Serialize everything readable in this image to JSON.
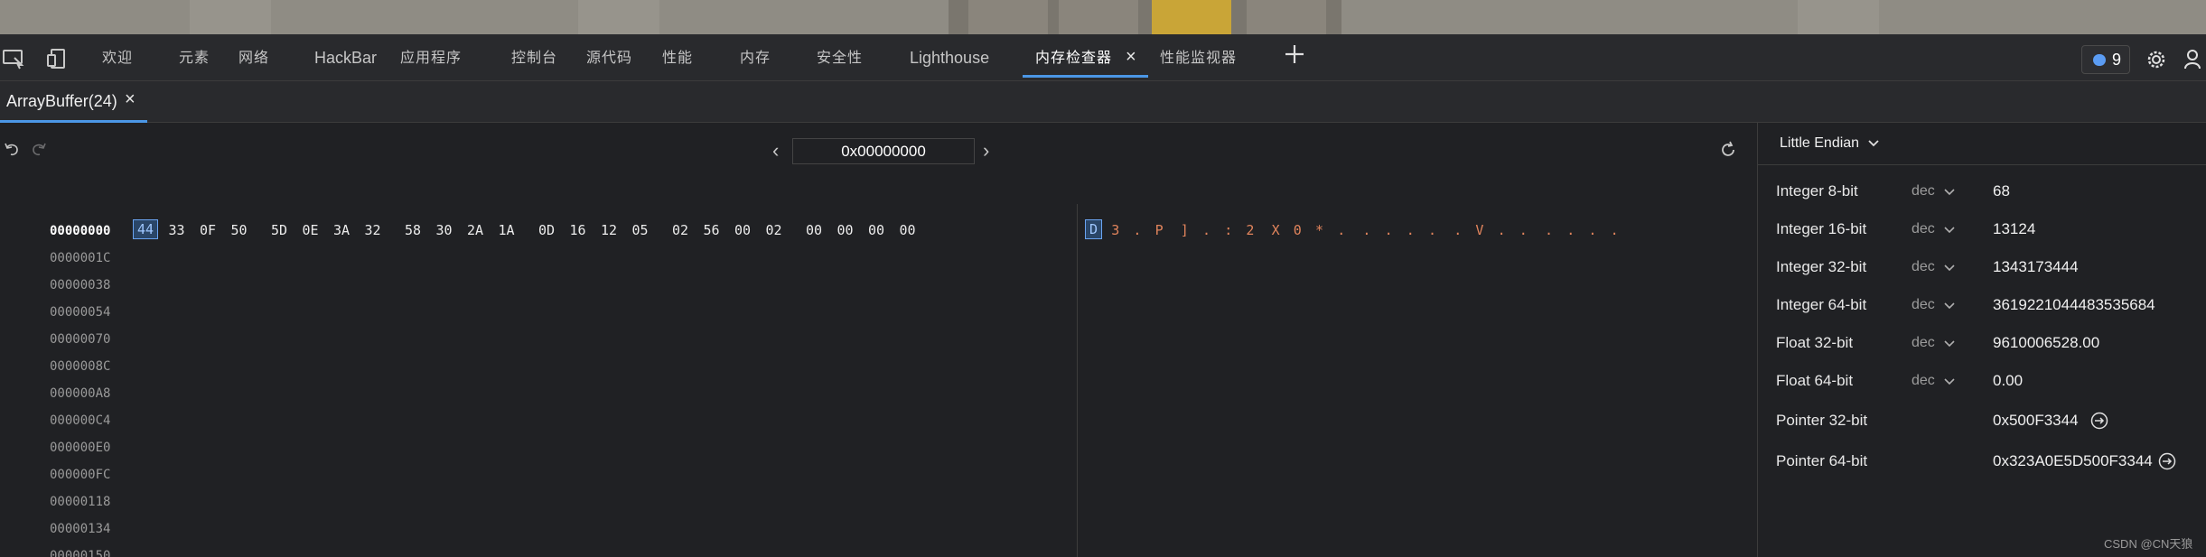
{
  "tabs": [
    {
      "label": "欢迎"
    },
    {
      "label": "元素"
    },
    {
      "label": "网络"
    },
    {
      "label": "HackBar"
    },
    {
      "label": "应用程序"
    },
    {
      "label": "控制台"
    },
    {
      "label": "源代码"
    },
    {
      "label": "性能"
    },
    {
      "label": "内存"
    },
    {
      "label": "安全性"
    },
    {
      "label": "Lighthouse"
    },
    {
      "label": "内存检查器",
      "active": true
    },
    {
      "label": "性能监视器"
    }
  ],
  "toolbar": {
    "issues_count": "9",
    "icons": [
      "inspect-element-icon",
      "device-toolbar-icon",
      "plus-icon",
      "issues-icon",
      "gear-icon",
      "customize-icon"
    ]
  },
  "subtab": {
    "label": "ArrayBuffer(24)"
  },
  "viewer": {
    "address": "0x00000000",
    "offsets": [
      "00000000",
      "0000001C",
      "00000038",
      "00000054",
      "00000070",
      "0000008C",
      "000000A8",
      "000000C4",
      "000000E0",
      "000000FC",
      "00000118",
      "00000134",
      "00000150"
    ],
    "bytes": [
      "44",
      "33",
      "0F",
      "50",
      "5D",
      "0E",
      "3A",
      "32",
      "58",
      "30",
      "2A",
      "1A",
      "0D",
      "16",
      "12",
      "05",
      "02",
      "56",
      "00",
      "02",
      "00",
      "00",
      "00",
      "00"
    ],
    "ascii": [
      "D",
      "3",
      ".",
      "P",
      "]",
      ".",
      ":",
      "2",
      "X",
      "0",
      "*",
      ".",
      ".",
      ".",
      ".",
      ".",
      ".",
      "V",
      ".",
      ".",
      ".",
      ".",
      ".",
      "."
    ],
    "selected_index": 0,
    "accent": "#e1845c"
  },
  "inspector": {
    "endianness": "Little Endian",
    "rows": [
      {
        "name": "Integer 8-bit",
        "mode": "dec",
        "value": "68"
      },
      {
        "name": "Integer 16-bit",
        "mode": "dec",
        "value": "13124"
      },
      {
        "name": "Integer 32-bit",
        "mode": "dec",
        "value": "1343173444"
      },
      {
        "name": "Integer 64-bit",
        "mode": "dec",
        "value": "3619221044483535684"
      },
      {
        "name": "Float 32-bit",
        "mode": "dec",
        "value": "9610006528.00"
      },
      {
        "name": "Float 64-bit",
        "mode": "dec",
        "value": "0.00"
      },
      {
        "name": "Pointer 32-bit",
        "mode": "",
        "value": "0x500F3344"
      },
      {
        "name": "Pointer 64-bit",
        "mode": "",
        "value": "0x323A0E5D500F3344"
      }
    ]
  },
  "watermark": "CSDN @CN天狼"
}
